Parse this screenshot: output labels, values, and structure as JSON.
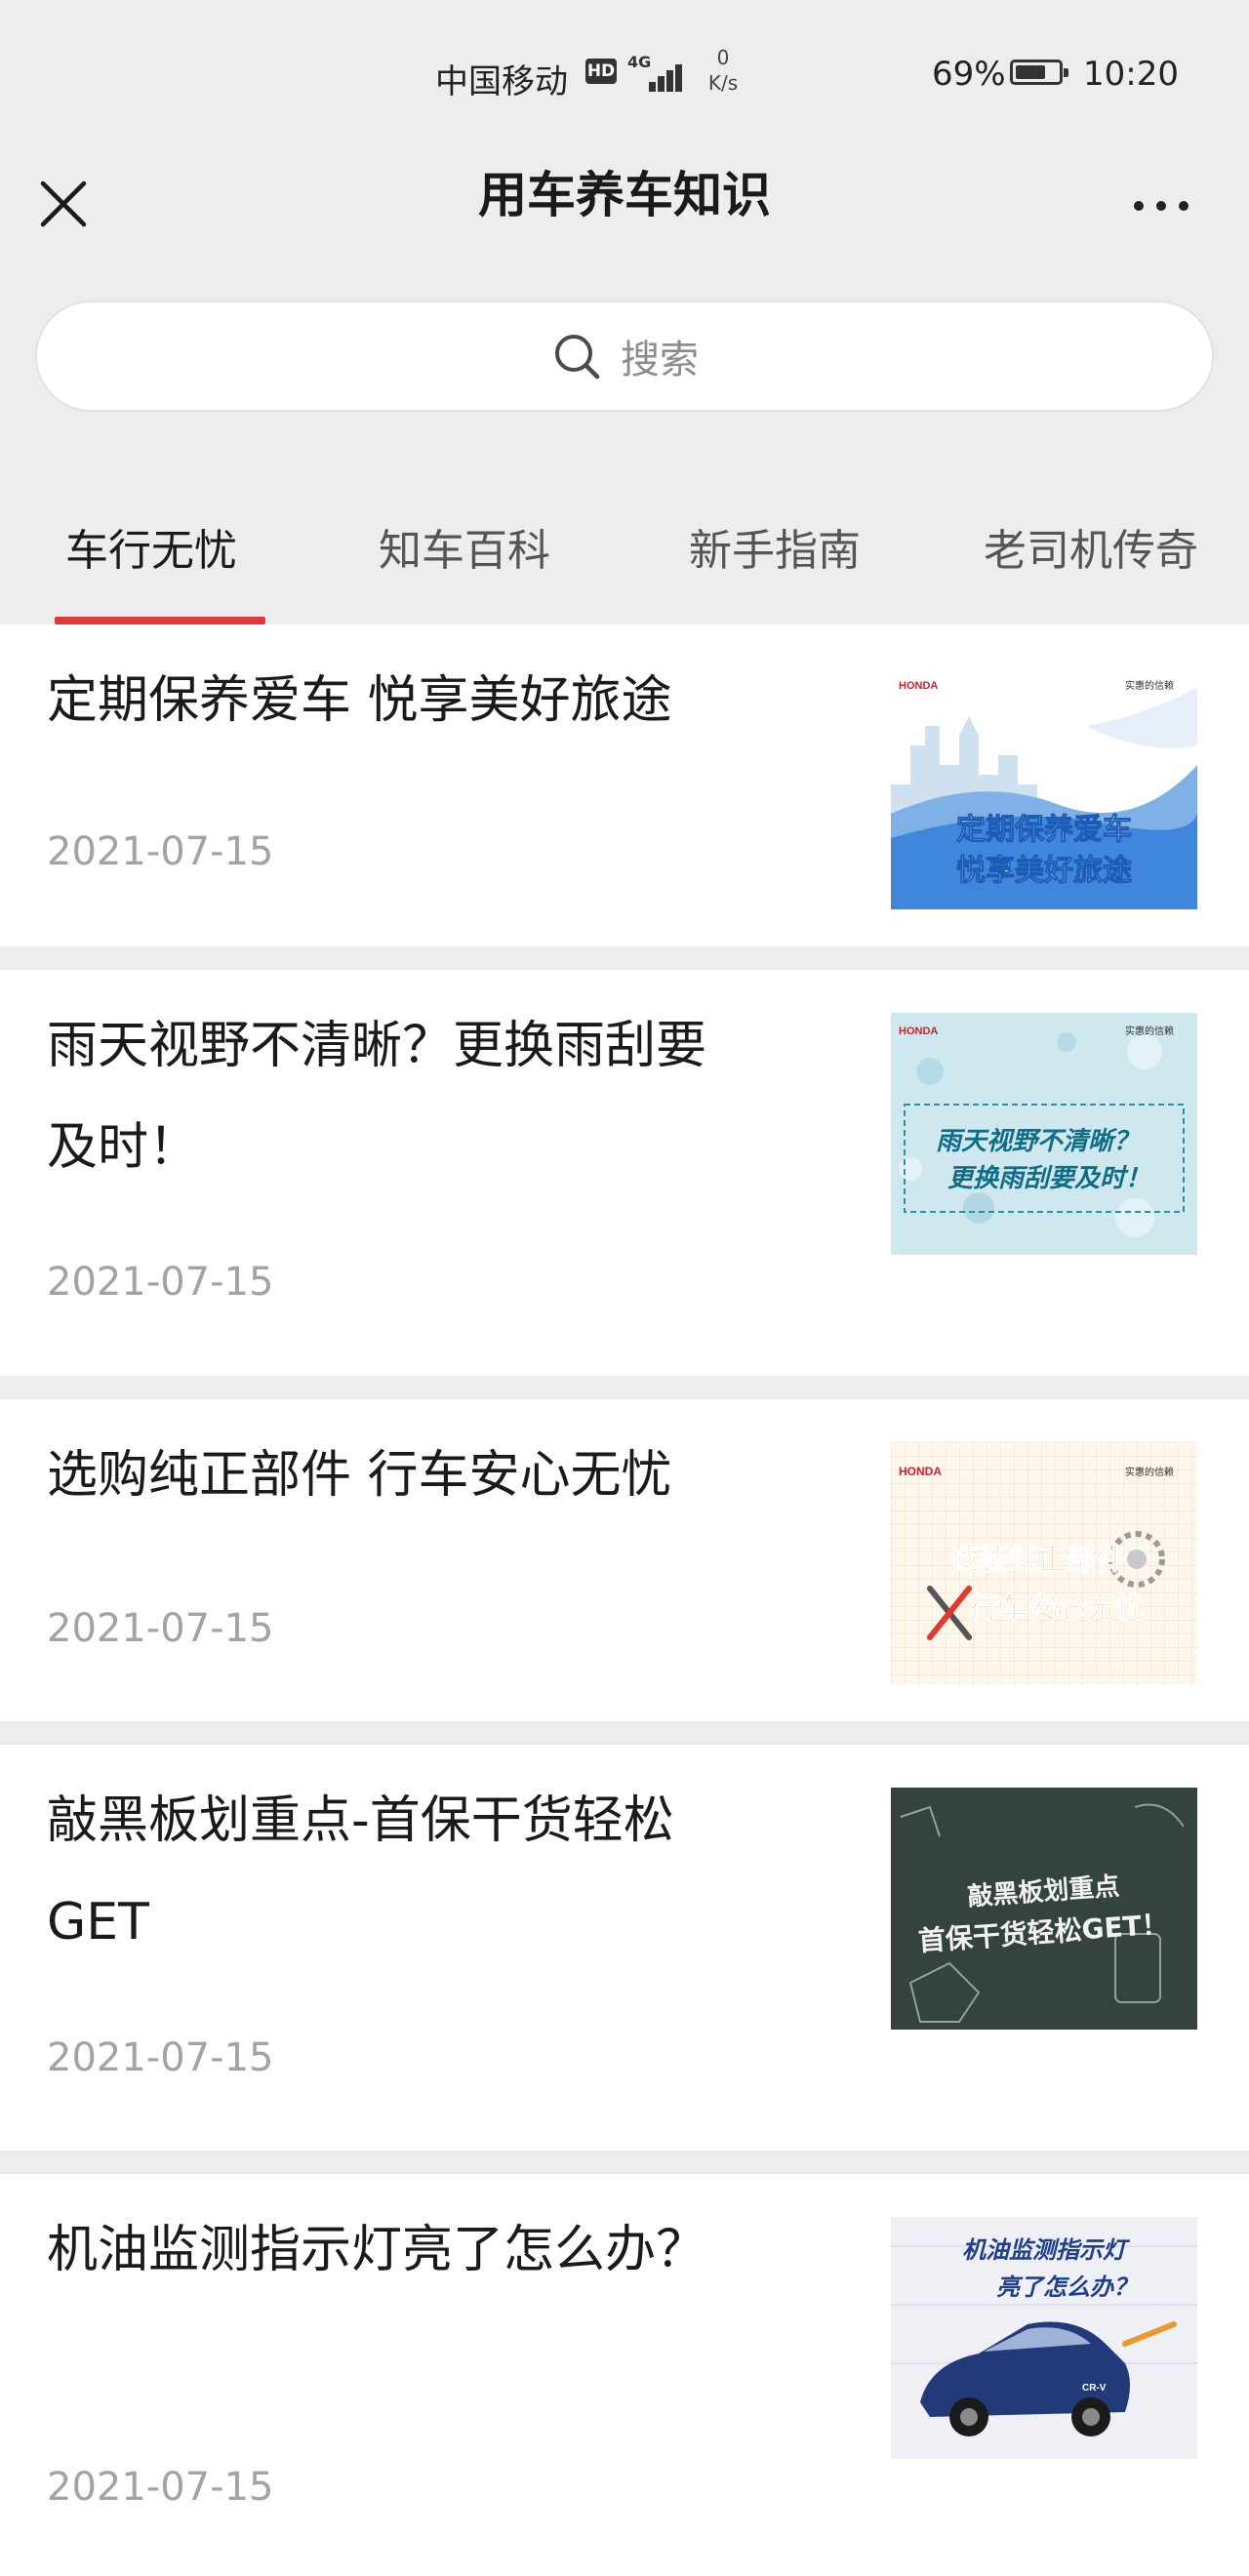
{
  "status_bar": {
    "carrier": "中国移动",
    "hd": "HD",
    "network": "4G",
    "speed_value": "0",
    "speed_unit": "K/s",
    "battery": "69%",
    "time": "10:20"
  },
  "header": {
    "title": "用车养车知识",
    "close_icon": "close-icon",
    "more_icon": "more-dots-icon"
  },
  "search": {
    "placeholder": "搜索",
    "icon": "search-icon"
  },
  "tabs": [
    {
      "label": "车行无忧",
      "active": true
    },
    {
      "label": "知车百科",
      "active": false
    },
    {
      "label": "新手指南",
      "active": false
    },
    {
      "label": "老司机传奇",
      "active": false
    }
  ],
  "accent_color": "#e0393c",
  "articles": [
    {
      "title": "定期保养爱车 悦享美好旅途",
      "date": "2021-07-15",
      "thumb": {
        "brand": "HONDA",
        "slogan": "实惠的信赖",
        "lines": [
          "定期保养爱车",
          "悦享美好旅途"
        ]
      }
    },
    {
      "title": "雨天视野不清晰？更换雨刮要及时！",
      "date": "2021-07-15",
      "thumb": {
        "brand": "HONDA",
        "slogan": "实惠的信赖",
        "lines": [
          "雨天视野不清晰？",
          "更换雨刮要及时！"
        ]
      }
    },
    {
      "title": "选购纯正部件 行车安心无忧",
      "date": "2021-07-15",
      "thumb": {
        "brand": "HONDA",
        "slogan": "实惠的信赖",
        "lines": [
          "选装纯正部件",
          "行车安心无忧"
        ]
      }
    },
    {
      "title": "敲黑板划重点-首保干货轻松GET",
      "date": "2021-07-15",
      "thumb": {
        "lines": [
          "敲黑板划重点",
          "首保干货轻松GET！"
        ]
      }
    },
    {
      "title": "机油监测指示灯亮了怎么办？",
      "date": "2021-07-15",
      "thumb": {
        "lines": [
          "机油监测指示灯",
          "亮了怎么办？"
        ],
        "car_badge": "CR-V"
      }
    }
  ]
}
